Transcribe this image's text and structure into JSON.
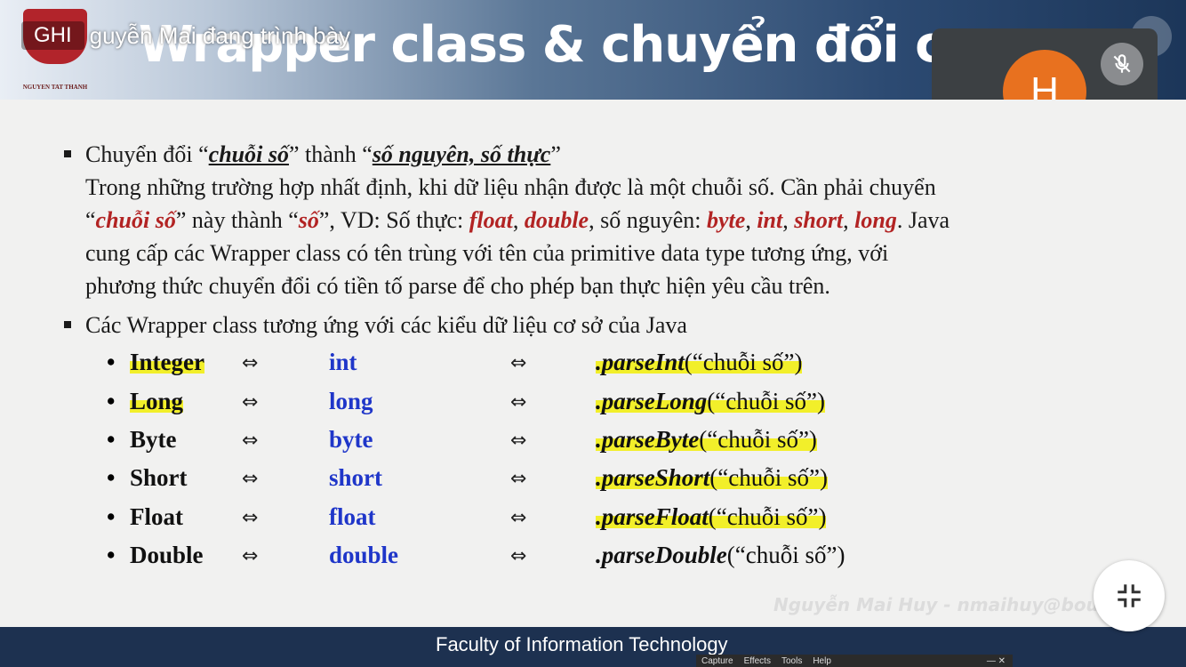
{
  "recording": {
    "badge": "GHI",
    "presenter_text": "guyễn Mai đang trình bày"
  },
  "slide": {
    "title": "Wrapper class & chuyển đổi c",
    "logo_caption": "NGUYEN TAT THANH",
    "bullet1": {
      "prefix": "Chuyển đổi “",
      "term1": "chuỗi số",
      "mid": "” thành “",
      "term2": "số nguyên, số thực",
      "suffix": "”"
    },
    "paragraph": {
      "line1": "Trong những trường hợp nhất định, khi dữ liệu nhận được là một chuỗi số. Cần phải chuyển",
      "l2_open": "“",
      "l2_chuoi": "chuỗi số",
      "l2_a": "” này thành “",
      "l2_so": "số",
      "l2_b": "”, VD: Số thực: ",
      "l2_float": "float",
      "l2_c": ", ",
      "l2_double": "double",
      "l2_d": ", số nguyên: ",
      "l2_byte": "byte",
      "l2_e": ", ",
      "l2_int": "int",
      "l2_f": ", ",
      "l2_short": "short",
      "l2_g": ", ",
      "l2_long": "long",
      "l2_h": ". Java",
      "line3": "cung cấp các Wrapper class có tên trùng với tên của primitive data type tương ứng, với",
      "line4": "phương thức chuyển đổi có tiền tố parse để cho phép bạn thực hiện yêu cầu trên."
    },
    "bullet2": "Các Wrapper class tương ứng với các kiểu dữ liệu cơ sở của Java",
    "rows": [
      {
        "wrapper": "Integer",
        "prim": "int",
        "method": ".parseInt",
        "arg": "(“chuỗi số”)"
      },
      {
        "wrapper": "Long",
        "prim": "long",
        "method": ".parseLong",
        "arg": "(“chuỗi số”)"
      },
      {
        "wrapper": "Byte",
        "prim": "byte",
        "method": ".parseByte",
        "arg": "(“chuỗi số”)"
      },
      {
        "wrapper": "Short",
        "prim": "short",
        "method": ".parseShort",
        "arg": "(“chuỗi số”)"
      },
      {
        "wrapper": "Float",
        "prim": "float",
        "method": ".parseFloat",
        "arg": "(“chuỗi số”)"
      },
      {
        "wrapper": "Double",
        "prim": "double",
        "method": ".parseDouble",
        "arg": "(“chuỗi số”)"
      }
    ],
    "bullet_dot": "•",
    "arrow": "⇔",
    "watermark": "Nguyễn Mai Huy - nmaihuy@bou   n",
    "footer": "Faculty of Information Technology"
  },
  "participant": {
    "initial": "H"
  },
  "capture_bar": {
    "capture": "Capture",
    "effects": "Effects",
    "tools": "Tools",
    "help": "Help",
    "controls": "—  ✕"
  },
  "colors": {
    "accent_red": "#b22323",
    "prim_blue": "#1f36c9",
    "highlight": "#f2ef2a",
    "avatar": "#e8711f"
  }
}
